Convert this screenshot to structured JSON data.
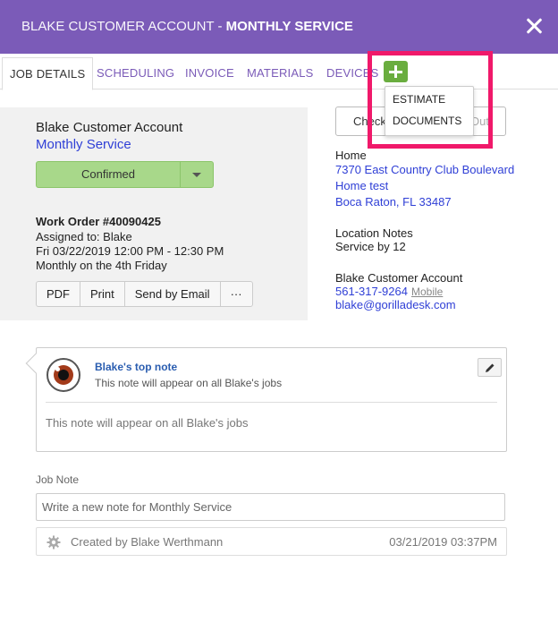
{
  "header": {
    "customer": "BLAKE CUSTOMER ACCOUNT",
    "separator": " - ",
    "service": "MONTHLY SERVICE"
  },
  "tabs": [
    {
      "label": "JOB DETAILS",
      "active": true
    },
    {
      "label": "SCHEDULING"
    },
    {
      "label": "INVOICE"
    },
    {
      "label": "MATERIALS"
    },
    {
      "label": "DEVICES"
    }
  ],
  "add_menu": {
    "items": [
      "ESTIMATE",
      "DOCUMENTS"
    ]
  },
  "job": {
    "customer_name": "Blake Customer Account",
    "service_name": "Monthly Service",
    "status": "Confirmed",
    "work_order": "Work Order #40090425",
    "assigned_to": "Assigned to: Blake",
    "datetime": "Fri 03/22/2019 12:00 PM - 12:30 PM",
    "recurrence": "Monthly on the 4th Friday",
    "actions": [
      "PDF",
      "Print",
      "Send by Email",
      "···"
    ]
  },
  "check": {
    "left_label": "Check In",
    "right_label": "Out"
  },
  "location": {
    "label": "Home",
    "street": "7370 East Country Club Boulevard",
    "name": "Home test",
    "city": "Boca Raton, FL 33487",
    "notes_label": "Location Notes",
    "notes": "Service by 12"
  },
  "contact": {
    "name": "Blake Customer Account",
    "phone": "561-317-9264",
    "phone_type": "Mobile",
    "email": "blake@gorilladesk.com"
  },
  "top_note": {
    "author": "Blake's top note",
    "subtitle": "This note will appear on all Blake's jobs",
    "body": "This note will appear on all Blake's jobs"
  },
  "job_note": {
    "label": "Job Note",
    "placeholder": "Write a new note for Monthly Service",
    "created_by": "Created by Blake Werthmann",
    "timestamp": "03/21/2019 03:37PM"
  },
  "colors": {
    "brand": "#7b5bb8",
    "add_button": "#6aad3f",
    "status": "#a8d88a",
    "highlight": "#f0196a",
    "link": "#2f3fd6"
  }
}
